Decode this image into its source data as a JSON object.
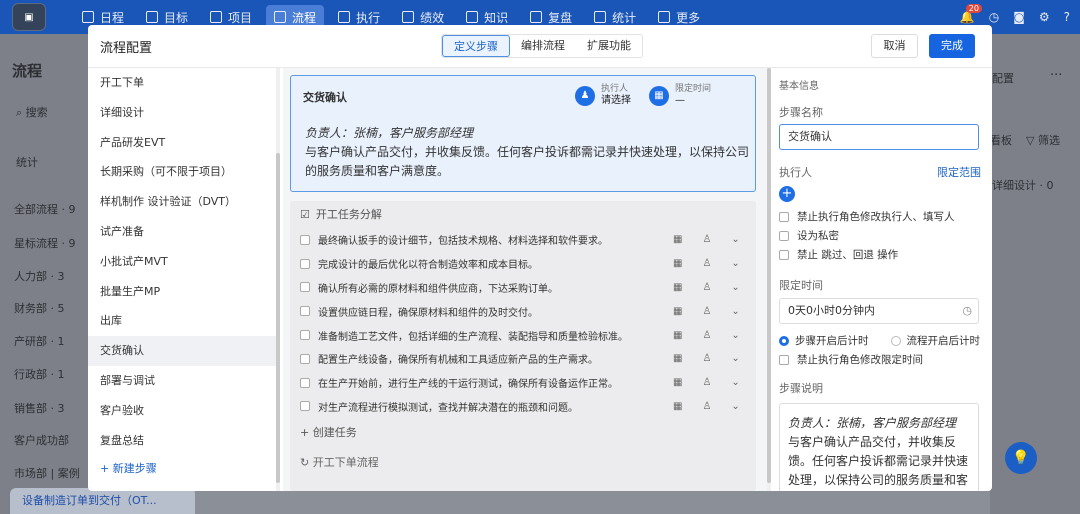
{
  "topnav": {
    "items": [
      "日程",
      "目标",
      "项目",
      "流程",
      "执行",
      "绩效",
      "知识",
      "复盘",
      "统计",
      "更多"
    ],
    "active_index": 3,
    "badge": "20"
  },
  "bg_left": {
    "title": "流程",
    "search": "搜索",
    "items": [
      "统计",
      "全部流程 · 9",
      "星标流程 · 9",
      "人力部 · 3",
      "财务部 · 5",
      "产研部 · 1",
      "行政部 · 1",
      "销售部 · 3",
      "客户成功部",
      "市场部 | 案例"
    ],
    "bottom": "设备制造订单到交付（OT..."
  },
  "bg_right": {
    "btn": "配置",
    "board": "看板",
    "filter": "筛选",
    "detail": "详细设计 · 0"
  },
  "modal": {
    "title": "流程配置",
    "tabs": [
      "定义步骤",
      "编排流程",
      "扩展功能"
    ],
    "cancel": "取消",
    "done": "完成",
    "steps": [
      "开工下单",
      "详细设计",
      "产品研发EVT",
      "长期采购（可不限于项目）",
      "样机制作 设计验证（DVT）",
      "试产准备",
      "小批试产MVT",
      "批量生产MP",
      "出库",
      "交货确认",
      "部署与调试",
      "客户验收",
      "复盘总结"
    ],
    "selected_step": "交货确认",
    "new_step": "+ 新建步骤",
    "card": {
      "title": "交货确认",
      "exec_label": "执行人",
      "exec_value": "请选择",
      "time_label": "限定时间",
      "time_value": "—",
      "owner": "负责人：张楠，客户服务部经理",
      "desc": "与客户确认产品交付，并收集反馈。任何客户投诉都需记录并快速处理，以保持公司的服务质量和客户满意度。"
    },
    "tasks_header": "开工任务分解",
    "tasks": [
      "最终确认扳手的设计细节，包括技术规格、材料选择和软件要求。",
      "完成设计的最后优化以符合制造效率和成本目标。",
      "确认所有必需的原材料和组件供应商，下达采购订单。",
      "设置供应链日程，确保原材料和组件的及时交付。",
      "准备制造工艺文件，包括详细的生产流程、装配指导和质量检验标准。",
      "配置生产线设备，确保所有机械和工具适应新产品的生产需求。",
      "在生产开始前，进行生产线的干运行测试，确保所有设备运作正常。",
      "对生产流程进行模拟测试，查找并解决潜在的瓶颈和问题。"
    ],
    "add_task": "+ 创建任务",
    "next_flow": "开工下单流程",
    "right": {
      "section": "基本信息",
      "name_label": "步骤名称",
      "name_value": "交货确认",
      "exec_label": "执行人",
      "scope_link": "限定范围",
      "opts": [
        "禁止执行角色修改执行人、填写人",
        "设为私密",
        "禁止 跳过、回退 操作"
      ],
      "time_label": "限定时间",
      "time_value": "0天0小时0分钟内",
      "radio1": "步骤开启后计时",
      "radio2": "流程开启后计时",
      "opt_time": "禁止执行角色修改限定时间",
      "desc_label": "步骤说明",
      "desc_owner": "负责人：张楠，客户服务部经理",
      "desc_text": "与客户确认产品交付，并收集反馈。任何客户投诉都需记录并快速处理，以保持公司的服务质量和客"
    }
  }
}
